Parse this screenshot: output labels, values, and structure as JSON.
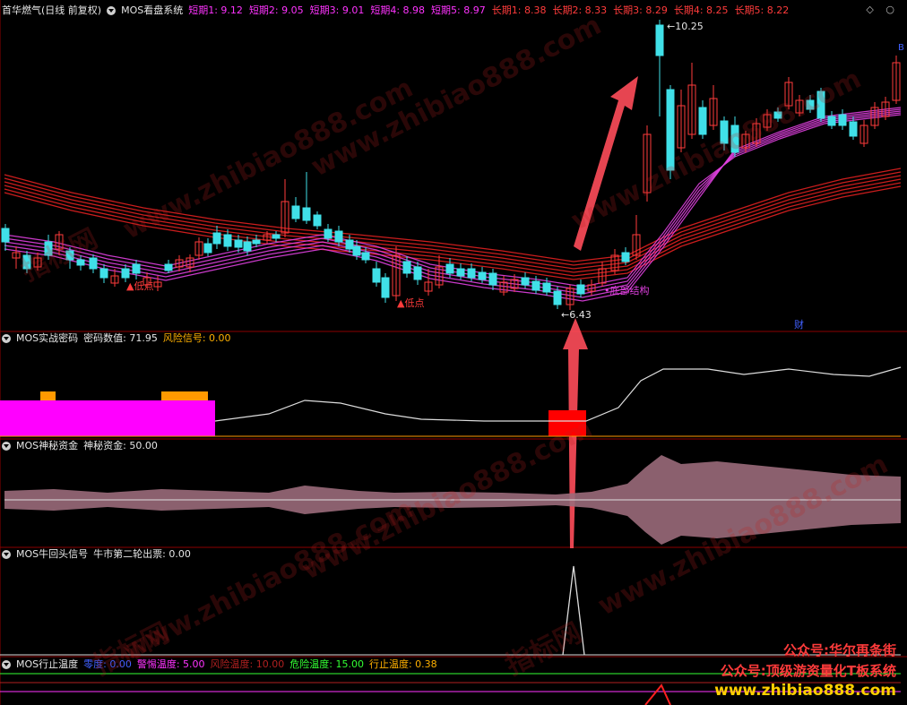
{
  "main": {
    "title": "首华燃气(日线 前复权)",
    "system": "MOS看盘系统",
    "ma_labels": [
      {
        "name": "短期1",
        "value": "9.12"
      },
      {
        "name": "短期2",
        "value": "9.05"
      },
      {
        "name": "短期3",
        "value": "9.01"
      },
      {
        "name": "短期4",
        "value": "8.98"
      },
      {
        "name": "短期5",
        "value": "8.97"
      },
      {
        "name": "长期1",
        "value": "8.38"
      },
      {
        "name": "长期2",
        "value": "8.33"
      },
      {
        "name": "长期3",
        "value": "8.29"
      },
      {
        "name": "长期4",
        "value": "8.25"
      },
      {
        "name": "长期5",
        "value": "8.22"
      }
    ],
    "high_label": "10.25",
    "low_label": "6.43",
    "annotations": {
      "low1": "▲低点",
      "low2": "▲低点",
      "bottom": "•底部结构",
      "cai": "财",
      "b": "B"
    }
  },
  "panel2": {
    "title": "MOS实战密码",
    "label1": "密码数值: 71.95",
    "label2": "风险信号: 0.00"
  },
  "panel3": {
    "title": "MOS神秘资金",
    "label1": "神秘资金: 50.00"
  },
  "panel4": {
    "title": "MOS牛回头信号",
    "label1": "牛市第二轮出票: 0.00"
  },
  "panel5": {
    "title": "MOS行止温度",
    "labels": [
      {
        "text": "零度: 0.00",
        "color": "#4060ff"
      },
      {
        "text": "警惕温度: 5.00",
        "color": "#ff33ff"
      },
      {
        "text": "风险温度: 10.00",
        "color": "#b02020"
      },
      {
        "text": "危险温度: 15.00",
        "color": "#33ff33"
      },
      {
        "text": "行止温度: 0.38",
        "color": "#ffb000"
      }
    ]
  },
  "promo": {
    "line1": "公众号:华尔再条街",
    "line2": "公众号:顶级游资量化T板系统",
    "line3": "www.zhibiao888.com"
  },
  "watermarks": [
    "www.zhibiao888.com",
    "指标网"
  ],
  "colors": {
    "up": "#ff3b3b",
    "down": "#40e0e8",
    "ma_short": "#e040e0",
    "ma_long": "#e02020",
    "divider": "#8b0000"
  },
  "chart_data": {
    "type": "candlestick",
    "series": [
      {
        "values": [
          9.12,
          9.05,
          9.01,
          8.98,
          8.97
        ]
      },
      {
        "values": [
          8.38,
          8.33,
          8.29,
          8.25,
          8.22
        ]
      }
    ],
    "price_high": 10.25,
    "price_low": 6.43
  }
}
